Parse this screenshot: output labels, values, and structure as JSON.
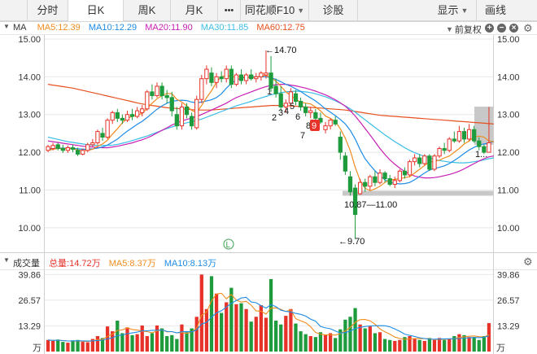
{
  "toolbar": {
    "tabs": [
      {
        "label": "分时",
        "active": false
      },
      {
        "label": "日K",
        "active": true
      },
      {
        "label": "周K",
        "active": false
      },
      {
        "label": "月K",
        "active": false
      },
      {
        "label": "•••",
        "active": false
      },
      {
        "label": "同花顺F10",
        "active": false,
        "dropdown": true
      },
      {
        "label": "诊股",
        "active": false
      }
    ],
    "display_label": "显示",
    "draw_label": "画线"
  },
  "main_panel": {
    "indicator": "MA",
    "ma": [
      {
        "label": "MA5:12.39",
        "color": "#f08c1e"
      },
      {
        "label": "MA10:12.29",
        "color": "#1e8ce6"
      },
      {
        "label": "MA20:11.90",
        "color": "#c81eb4"
      },
      {
        "label": "MA30:11.85",
        "color": "#3cbde6"
      },
      {
        "label": "MA60:12.75",
        "color": "#e6501e"
      }
    ],
    "adjust_label": "前复权",
    "price_ticks": [
      "15.00",
      "14.00",
      "13.00",
      "12.00",
      "11.00",
      "10.00"
    ],
    "right_partial_label": "1...",
    "high_label": "←14.70",
    "low_label": "←9.70",
    "support_label": "10.87—11.00",
    "sequence_labels": [
      "1",
      "2",
      "3",
      "4",
      "5",
      "6",
      "7",
      "8",
      "9"
    ],
    "l_marker": "L"
  },
  "volume_panel": {
    "title": "成交量",
    "total": {
      "label": "总量:14.72万",
      "color": "#e63228"
    },
    "ma5": {
      "label": "MA5:8.37万",
      "color": "#f08c1e"
    },
    "ma10": {
      "label": "MA10:8.13万",
      "color": "#1e8ce6"
    },
    "ticks": [
      "39.86",
      "26.57",
      "13.29"
    ],
    "unit": "万"
  },
  "colors": {
    "up": "#e63228",
    "down": "#1e9b3c",
    "toolbar_bg": "#f2f2f2",
    "grid": "#e8e8e8"
  },
  "chart_data": {
    "type": "candlestick",
    "ylim": [
      9.5,
      15.0
    ],
    "volume_ylim": [
      0,
      40
    ],
    "candles": [
      {
        "o": 12.05,
        "h": 12.2,
        "l": 12.0,
        "c": 12.15,
        "v": 6.0
      },
      {
        "o": 12.1,
        "h": 12.25,
        "l": 12.05,
        "c": 12.18,
        "v": 5.5
      },
      {
        "o": 12.2,
        "h": 12.25,
        "l": 12.05,
        "c": 12.1,
        "v": 6.2
      },
      {
        "o": 12.1,
        "h": 12.2,
        "l": 11.98,
        "c": 12.05,
        "v": 5.0
      },
      {
        "o": 12.05,
        "h": 12.18,
        "l": 11.98,
        "c": 12.12,
        "v": 4.6
      },
      {
        "o": 12.12,
        "h": 12.2,
        "l": 12.0,
        "c": 12.08,
        "v": 5.8
      },
      {
        "o": 12.05,
        "h": 12.12,
        "l": 11.9,
        "c": 11.95,
        "v": 6.0
      },
      {
        "o": 11.95,
        "h": 12.1,
        "l": 11.92,
        "c": 12.05,
        "v": 5.0
      },
      {
        "o": 12.05,
        "h": 12.25,
        "l": 12.0,
        "c": 12.2,
        "v": 4.8
      },
      {
        "o": 12.2,
        "h": 12.35,
        "l": 12.15,
        "c": 12.25,
        "v": 6.5
      },
      {
        "o": 12.25,
        "h": 12.6,
        "l": 12.2,
        "c": 12.55,
        "v": 8.0
      },
      {
        "o": 12.5,
        "h": 12.65,
        "l": 12.3,
        "c": 12.4,
        "v": 7.0
      },
      {
        "o": 12.4,
        "h": 12.9,
        "l": 12.35,
        "c": 12.85,
        "v": 13.0
      },
      {
        "o": 12.85,
        "h": 13.1,
        "l": 12.75,
        "c": 13.05,
        "v": 10.5
      },
      {
        "o": 13.05,
        "h": 13.15,
        "l": 12.8,
        "c": 12.9,
        "v": 16.0
      },
      {
        "o": 12.9,
        "h": 13.0,
        "l": 12.75,
        "c": 12.85,
        "v": 9.5
      },
      {
        "o": 12.85,
        "h": 13.1,
        "l": 12.8,
        "c": 13.0,
        "v": 12.5
      },
      {
        "o": 13.0,
        "h": 13.15,
        "l": 12.85,
        "c": 12.95,
        "v": 8.5
      },
      {
        "o": 12.95,
        "h": 13.2,
        "l": 12.9,
        "c": 13.1,
        "v": 9.0
      },
      {
        "o": 13.05,
        "h": 13.25,
        "l": 12.95,
        "c": 13.15,
        "v": 13.5
      },
      {
        "o": 13.15,
        "h": 13.65,
        "l": 13.1,
        "c": 13.6,
        "v": 8.0
      },
      {
        "o": 13.6,
        "h": 13.8,
        "l": 13.4,
        "c": 13.5,
        "v": 9.5
      },
      {
        "o": 13.5,
        "h": 13.85,
        "l": 13.45,
        "c": 13.75,
        "v": 13.5
      },
      {
        "o": 13.75,
        "h": 13.85,
        "l": 13.4,
        "c": 13.5,
        "v": 12.0
      },
      {
        "o": 13.5,
        "h": 13.65,
        "l": 13.3,
        "c": 13.45,
        "v": 8.0
      },
      {
        "o": 13.45,
        "h": 13.6,
        "l": 12.95,
        "c": 13.1,
        "v": 8.5
      },
      {
        "o": 13.0,
        "h": 13.2,
        "l": 12.6,
        "c": 12.7,
        "v": 6.5
      },
      {
        "o": 12.7,
        "h": 13.3,
        "l": 12.6,
        "c": 13.2,
        "v": 14.0
      },
      {
        "o": 13.2,
        "h": 13.3,
        "l": 12.9,
        "c": 13.0,
        "v": 10.0
      },
      {
        "o": 12.95,
        "h": 13.05,
        "l": 12.6,
        "c": 12.7,
        "v": 12.0
      },
      {
        "o": 12.65,
        "h": 13.5,
        "l": 12.6,
        "c": 13.4,
        "v": 18.0
      },
      {
        "o": 13.4,
        "h": 14.05,
        "l": 13.3,
        "c": 13.95,
        "v": 39.86
      },
      {
        "o": 13.95,
        "h": 14.3,
        "l": 13.8,
        "c": 14.2,
        "v": 22.0
      },
      {
        "o": 14.1,
        "h": 14.25,
        "l": 13.75,
        "c": 13.85,
        "v": 39.0
      },
      {
        "o": 13.85,
        "h": 14.1,
        "l": 13.7,
        "c": 14.0,
        "v": 30.0
      },
      {
        "o": 14.0,
        "h": 14.15,
        "l": 13.85,
        "c": 13.95,
        "v": 20.0
      },
      {
        "o": 13.95,
        "h": 14.3,
        "l": 13.85,
        "c": 14.2,
        "v": 25.5
      },
      {
        "o": 14.2,
        "h": 14.3,
        "l": 13.7,
        "c": 13.8,
        "v": 33.0
      },
      {
        "o": 13.8,
        "h": 14.1,
        "l": 13.75,
        "c": 14.05,
        "v": 24.5
      },
      {
        "o": 14.05,
        "h": 14.2,
        "l": 13.8,
        "c": 13.9,
        "v": 25.0
      },
      {
        "o": 13.9,
        "h": 14.1,
        "l": 13.8,
        "c": 14.05,
        "v": 22.0
      },
      {
        "o": 14.05,
        "h": 14.2,
        "l": 13.9,
        "c": 13.95,
        "v": 15.5
      },
      {
        "o": 13.95,
        "h": 14.1,
        "l": 13.85,
        "c": 14.0,
        "v": 18.0
      },
      {
        "o": 14.0,
        "h": 14.15,
        "l": 13.9,
        "c": 14.1,
        "v": 24.0
      },
      {
        "o": 14.05,
        "h": 14.7,
        "l": 13.95,
        "c": 14.1,
        "v": 17.5
      },
      {
        "o": 14.1,
        "h": 14.55,
        "l": 13.6,
        "c": 13.7,
        "v": 37.5
      },
      {
        "o": 13.75,
        "h": 13.95,
        "l": 13.45,
        "c": 13.55,
        "v": 16.0
      },
      {
        "o": 13.55,
        "h": 13.75,
        "l": 13.1,
        "c": 13.2,
        "v": 14.0
      },
      {
        "o": 13.2,
        "h": 13.4,
        "l": 13.05,
        "c": 13.3,
        "v": 18.5
      },
      {
        "o": 13.3,
        "h": 13.7,
        "l": 13.2,
        "c": 13.6,
        "v": 22.0
      },
      {
        "o": 13.55,
        "h": 13.65,
        "l": 13.25,
        "c": 13.35,
        "v": 14.5
      },
      {
        "o": 13.35,
        "h": 13.45,
        "l": 13.1,
        "c": 13.2,
        "v": 10.5
      },
      {
        "o": 13.2,
        "h": 13.3,
        "l": 12.95,
        "c": 13.05,
        "v": 9.0
      },
      {
        "o": 13.05,
        "h": 13.2,
        "l": 12.9,
        "c": 13.1,
        "v": 8.0
      },
      {
        "o": 13.05,
        "h": 13.15,
        "l": 12.8,
        "c": 12.9,
        "v": 7.5
      },
      {
        "o": 12.9,
        "h": 13.05,
        "l": 12.75,
        "c": 12.8,
        "v": 10.0
      },
      {
        "o": 12.6,
        "h": 12.8,
        "l": 12.5,
        "c": 12.7,
        "v": 8.5
      },
      {
        "o": 12.7,
        "h": 12.9,
        "l": 12.6,
        "c": 12.85,
        "v": 9.5
      },
      {
        "o": 12.85,
        "h": 12.95,
        "l": 12.7,
        "c": 12.75,
        "v": 7.0
      },
      {
        "o": 12.4,
        "h": 12.55,
        "l": 11.8,
        "c": 12.0,
        "v": 11.5
      },
      {
        "o": 11.9,
        "h": 12.0,
        "l": 11.4,
        "c": 11.5,
        "v": 16.5
      },
      {
        "o": 11.35,
        "h": 11.5,
        "l": 10.85,
        "c": 10.95,
        "v": 18.0
      },
      {
        "o": 11.05,
        "h": 11.15,
        "l": 9.7,
        "c": 10.35,
        "v": 22.5
      },
      {
        "o": 10.9,
        "h": 11.3,
        "l": 10.87,
        "c": 11.2,
        "v": 14.0
      },
      {
        "o": 11.2,
        "h": 11.3,
        "l": 10.95,
        "c": 11.1,
        "v": 12.0
      },
      {
        "o": 11.1,
        "h": 11.4,
        "l": 11.0,
        "c": 11.35,
        "v": 13.0
      },
      {
        "o": 11.35,
        "h": 11.5,
        "l": 11.1,
        "c": 11.2,
        "v": 9.5
      },
      {
        "o": 11.2,
        "h": 11.55,
        "l": 11.15,
        "c": 11.45,
        "v": 10.0
      },
      {
        "o": 11.45,
        "h": 11.5,
        "l": 11.2,
        "c": 11.3,
        "v": 6.5
      },
      {
        "o": 11.3,
        "h": 11.4,
        "l": 11.1,
        "c": 11.15,
        "v": 6.0
      },
      {
        "o": 11.15,
        "h": 11.35,
        "l": 11.05,
        "c": 11.25,
        "v": 5.5
      },
      {
        "o": 11.25,
        "h": 11.55,
        "l": 11.2,
        "c": 11.5,
        "v": 6.0
      },
      {
        "o": 11.5,
        "h": 11.6,
        "l": 11.3,
        "c": 11.4,
        "v": 7.5
      },
      {
        "o": 11.4,
        "h": 11.8,
        "l": 11.35,
        "c": 11.75,
        "v": 8.0
      },
      {
        "o": 11.75,
        "h": 11.95,
        "l": 11.65,
        "c": 11.85,
        "v": 6.5
      },
      {
        "o": 11.85,
        "h": 11.95,
        "l": 11.6,
        "c": 11.7,
        "v": 6.0
      },
      {
        "o": 11.7,
        "h": 11.95,
        "l": 11.65,
        "c": 11.9,
        "v": 5.5
      },
      {
        "o": 11.9,
        "h": 11.95,
        "l": 11.5,
        "c": 11.55,
        "v": 7.0
      },
      {
        "o": 11.55,
        "h": 11.95,
        "l": 11.5,
        "c": 11.9,
        "v": 6.0
      },
      {
        "o": 11.9,
        "h": 12.15,
        "l": 11.85,
        "c": 12.1,
        "v": 7.0
      },
      {
        "o": 12.1,
        "h": 12.25,
        "l": 11.95,
        "c": 12.05,
        "v": 6.0
      },
      {
        "o": 12.05,
        "h": 12.4,
        "l": 12.0,
        "c": 12.35,
        "v": 6.5
      },
      {
        "o": 12.35,
        "h": 12.55,
        "l": 12.25,
        "c": 12.3,
        "v": 8.0
      },
      {
        "o": 12.3,
        "h": 12.7,
        "l": 12.25,
        "c": 12.55,
        "v": 9.0
      },
      {
        "o": 12.55,
        "h": 12.65,
        "l": 12.25,
        "c": 12.35,
        "v": 8.5
      },
      {
        "o": 12.35,
        "h": 12.75,
        "l": 12.3,
        "c": 12.6,
        "v": 7.5
      },
      {
        "o": 12.6,
        "h": 12.7,
        "l": 12.25,
        "c": 12.3,
        "v": 7.5
      },
      {
        "o": 12.3,
        "h": 12.4,
        "l": 12.05,
        "c": 12.15,
        "v": 6.0
      },
      {
        "o": 12.15,
        "h": 12.2,
        "l": 11.95,
        "c": 12.0,
        "v": 8.0
      },
      {
        "o": 12.0,
        "h": 13.2,
        "l": 12.0,
        "c": 12.25,
        "v": 14.72
      }
    ],
    "ma5": [
      12.05,
      12.08,
      12.1,
      12.1,
      12.1,
      12.09,
      12.06,
      12.04,
      12.05,
      12.08,
      12.16,
      12.22,
      12.32,
      12.48,
      12.62,
      12.78,
      12.9,
      12.95,
      12.98,
      13.03,
      13.16,
      13.3,
      13.42,
      13.5,
      13.56,
      13.55,
      13.4,
      13.33,
      13.23,
      13.11,
      13.05,
      13.24,
      13.45,
      13.63,
      13.86,
      14.0,
      14.04,
      14.0,
      14.0,
      14.0,
      13.99,
      13.97,
      13.99,
      14.02,
      14.04,
      13.97,
      13.89,
      13.75,
      13.6,
      13.5,
      13.4,
      13.33,
      13.3,
      13.28,
      13.2,
      13.1,
      12.96,
      12.9,
      12.81,
      12.62,
      12.37,
      12.04,
      11.6,
      11.25,
      11.05,
      10.98,
      11.03,
      11.1,
      11.2,
      11.27,
      11.28,
      11.3,
      11.33,
      11.35,
      11.45,
      11.55,
      11.65,
      11.74,
      11.76,
      11.79,
      11.85,
      11.9,
      12.0,
      12.1,
      12.22,
      12.3,
      12.4,
      12.43,
      12.4,
      12.3,
      12.28
    ],
    "ma10": [
      12.08,
      12.1,
      12.11,
      12.11,
      12.11,
      12.1,
      12.09,
      12.08,
      12.08,
      12.09,
      12.11,
      12.14,
      12.19,
      12.27,
      12.35,
      12.46,
      12.56,
      12.65,
      12.74,
      12.82,
      12.92,
      13.03,
      13.14,
      13.23,
      13.3,
      13.35,
      13.37,
      13.38,
      13.37,
      13.33,
      13.31,
      13.33,
      13.36,
      13.39,
      13.45,
      13.55,
      13.7,
      13.82,
      13.92,
      13.96,
      13.99,
      14.0,
      14.0,
      14.0,
      14.0,
      13.98,
      13.93,
      13.87,
      13.8,
      13.75,
      13.68,
      13.61,
      13.52,
      13.44,
      13.36,
      13.26,
      13.15,
      13.06,
      12.97,
      12.87,
      12.75,
      12.58,
      12.35,
      12.07,
      11.83,
      11.66,
      11.51,
      11.38,
      11.27,
      11.2,
      11.18,
      11.16,
      11.17,
      11.2,
      11.27,
      11.36,
      11.45,
      11.53,
      11.57,
      11.6,
      11.64,
      11.7,
      11.78,
      11.87,
      11.97,
      12.06,
      12.13,
      12.19,
      12.22,
      12.24,
      12.29
    ],
    "ma20": [
      12.3,
      12.28,
      12.26,
      12.24,
      12.22,
      12.2,
      12.18,
      12.16,
      12.15,
      12.14,
      12.13,
      12.12,
      12.12,
      12.14,
      12.16,
      12.19,
      12.22,
      12.25,
      12.29,
      12.33,
      12.38,
      12.44,
      12.51,
      12.58,
      12.65,
      12.72,
      12.78,
      12.83,
      12.87,
      12.91,
      12.95,
      13.0,
      13.06,
      13.12,
      13.18,
      13.24,
      13.3,
      13.38,
      13.45,
      13.5,
      13.55,
      13.6,
      13.65,
      13.7,
      13.74,
      13.77,
      13.79,
      13.8,
      13.8,
      13.78,
      13.76,
      13.73,
      13.7,
      13.66,
      13.62,
      13.57,
      13.52,
      13.46,
      13.39,
      13.31,
      13.22,
      13.1,
      12.96,
      12.8,
      12.63,
      12.46,
      12.28,
      12.1,
      11.94,
      11.8,
      11.68,
      11.58,
      11.49,
      11.42,
      11.37,
      11.34,
      11.32,
      11.32,
      11.33,
      11.35,
      11.38,
      11.41,
      11.45,
      11.5,
      11.56,
      11.63,
      11.7,
      11.77,
      11.83,
      11.88,
      11.9
    ],
    "ma30": [
      12.4,
      12.37,
      12.34,
      12.31,
      12.28,
      12.26,
      12.24,
      12.22,
      12.2,
      12.19,
      12.18,
      12.18,
      12.18,
      12.19,
      12.21,
      12.24,
      12.27,
      12.31,
      12.35,
      12.39,
      12.43,
      12.48,
      12.53,
      12.58,
      12.63,
      12.67,
      12.71,
      12.75,
      12.78,
      12.81,
      12.84,
      12.88,
      12.93,
      12.98,
      13.03,
      13.08,
      13.13,
      13.18,
      13.23,
      13.27,
      13.31,
      13.35,
      13.4,
      13.44,
      13.48,
      13.52,
      13.55,
      13.58,
      13.6,
      13.61,
      13.62,
      13.61,
      13.6,
      13.58,
      13.55,
      13.51,
      13.47,
      13.42,
      13.36,
      13.3,
      13.23,
      13.15,
      13.06,
      12.96,
      12.86,
      12.76,
      12.66,
      12.56,
      12.46,
      12.37,
      12.28,
      12.2,
      12.12,
      12.05,
      11.99,
      11.94,
      11.89,
      11.85,
      11.81,
      11.78,
      11.76,
      11.74,
      11.73,
      11.72,
      11.72,
      11.73,
      11.75,
      11.77,
      11.8,
      11.83,
      11.85
    ],
    "ma60": [
      13.8,
      13.78,
      13.76,
      13.74,
      13.72,
      13.7,
      13.67,
      13.64,
      13.61,
      13.58,
      13.55,
      13.52,
      13.49,
      13.46,
      13.43,
      13.4,
      13.37,
      13.34,
      13.31,
      13.28,
      13.26,
      13.24,
      13.22,
      13.2,
      13.18,
      13.17,
      13.16,
      13.15,
      13.14,
      13.13,
      13.12,
      13.12,
      13.12,
      13.12,
      13.13,
      13.14,
      13.15,
      13.16,
      13.17,
      13.18,
      13.19,
      13.2,
      13.21,
      13.22,
      13.23,
      13.24,
      13.24,
      13.24,
      13.24,
      13.23,
      13.22,
      13.21,
      13.2,
      13.19,
      13.18,
      13.17,
      13.16,
      13.15,
      13.14,
      13.13,
      13.12,
      13.1,
      13.08,
      13.06,
      13.04,
      13.02,
      13.0,
      12.98,
      12.97,
      12.96,
      12.95,
      12.94,
      12.93,
      12.92,
      12.91,
      12.9,
      12.89,
      12.88,
      12.87,
      12.86,
      12.85,
      12.84,
      12.83,
      12.82,
      12.81,
      12.8,
      12.79,
      12.78,
      12.77,
      12.76,
      12.75
    ]
  }
}
